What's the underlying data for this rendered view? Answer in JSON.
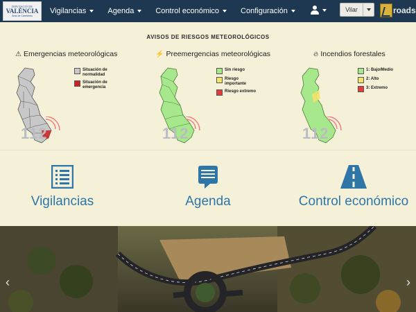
{
  "navbar": {
    "logo": {
      "line1": "DIPUTACIÓ DE",
      "line2": "VALÈNCIA",
      "line3": "Àrea de Carreteres"
    },
    "menu": [
      {
        "label": "Vigilancias"
      },
      {
        "label": "Agenda"
      },
      {
        "label": "Control económico"
      },
      {
        "label": "Configuración"
      }
    ],
    "user_selector": {
      "value": "Vilar"
    },
    "brand": {
      "text": "roads"
    }
  },
  "alerts": {
    "title": "Avisos de riesgos meteorológicos",
    "emergency_number": "112",
    "panels": [
      {
        "heading": "Emergencias meteorológicas",
        "icon": "warning-icon",
        "legend": [
          {
            "label": "Situación de normalidad",
            "color": "#c9c9c9"
          },
          {
            "label": "Situación de emergencia",
            "color": "#cc2222"
          }
        ]
      },
      {
        "heading": "Preemergencias meteorológicas",
        "icon": "lightning-icon",
        "legend": [
          {
            "label": "Sin riesgo",
            "color": "#a8e88c"
          },
          {
            "label": "Riesgo importante",
            "color": "#f3e36a"
          },
          {
            "label": "Riesgo extremo",
            "color": "#e23c3c"
          }
        ]
      },
      {
        "heading": "Incendios forestales",
        "icon": "fire-icon",
        "legend": [
          {
            "label": "1: Bajo/Medio",
            "color": "#a8e88c"
          },
          {
            "label": "2: Alto",
            "color": "#f3e36a"
          },
          {
            "label": "3: Extremo",
            "color": "#e23c3c"
          }
        ]
      }
    ]
  },
  "features": [
    {
      "label": "Vigilancias",
      "icon": "list-icon"
    },
    {
      "label": "Agenda",
      "icon": "chat-icon"
    },
    {
      "label": "Control económico",
      "icon": "road-icon"
    }
  ],
  "carousel": {
    "prev_icon": "chevron-left-icon",
    "next_icon": "chevron-right-icon",
    "prev_glyph": "‹",
    "next_glyph": "›"
  },
  "colors": {
    "navbar": "#1d3850",
    "accent": "#2e76a7",
    "background": "#f4f1d8"
  }
}
